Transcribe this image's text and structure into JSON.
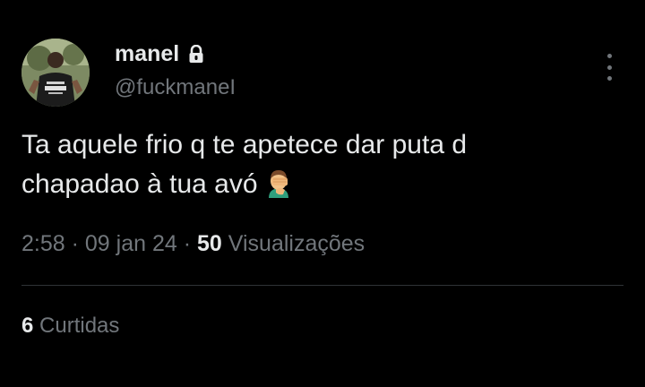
{
  "tweet": {
    "author": {
      "display_name": "manel",
      "handle": "@fuckmaneI",
      "protected_icon": "lock-icon",
      "avatar_icon": "avatar"
    },
    "text_line1": "Ta aquele frio q te apetece dar puta d",
    "text_line2": "chapadao à tua avó",
    "emoji": "face-palm-emoji",
    "time": "2:58",
    "separator": "·",
    "date": "09 jan 24",
    "views_count": "50",
    "views_label": "Visualizações",
    "likes_count": "6",
    "likes_label": "Curtidas",
    "more_icon": "more-vertical-icon"
  },
  "colors": {
    "background": "#000000",
    "primary_text": "#e7e9ea",
    "secondary_text": "#71767b",
    "divider": "#2f3336"
  }
}
